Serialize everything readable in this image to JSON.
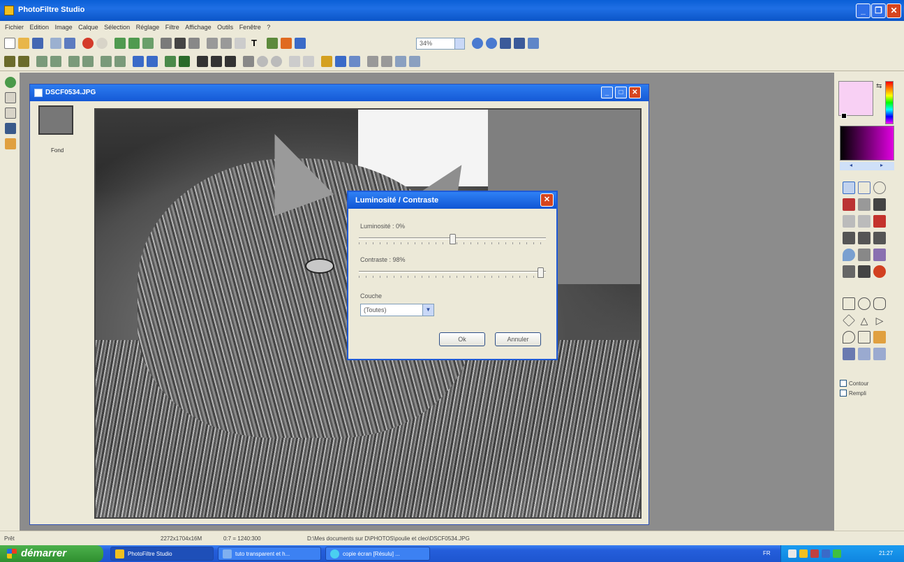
{
  "app": {
    "title": "PhotoFiltre Studio"
  },
  "menu": [
    "Fichier",
    "Edition",
    "Image",
    "Calque",
    "Sélection",
    "Réglage",
    "Filtre",
    "Affichage",
    "Outils",
    "Fenêtre",
    "?"
  ],
  "toolbar": {
    "zoom": "34%"
  },
  "image_window": {
    "title": "DSCF0534.JPG",
    "layer_label": "Fond"
  },
  "dialog": {
    "title": "Luminosité / Contraste",
    "brightness_label": "Luminosité : 0%",
    "brightness_value": 0,
    "contrast_label": "Contraste : 98%",
    "contrast_value": 98,
    "layer_label": "Couche",
    "layer_select": "(Toutes)",
    "ok": "Ok",
    "cancel": "Annuler"
  },
  "right_panel": {
    "contour": "Contour",
    "fill": "Rempli",
    "foreground_color": "#f8d0f4",
    "background_color": "#000000"
  },
  "status": {
    "state": "Prêt",
    "size": "2272x1704x16M",
    "zoom_info": "0:7 = 1240:300",
    "path": "D:\\Mes documents sur D\\PHOTOS\\poulie et cleo\\DSCF0534.JPG"
  },
  "taskbar": {
    "start": "démarrer",
    "tasks": [
      "PhotoFiltre Studio",
      "tuto transparent et h...",
      "copie écran [Résulu] ..."
    ],
    "lang": "FR",
    "clock": "21:27"
  }
}
